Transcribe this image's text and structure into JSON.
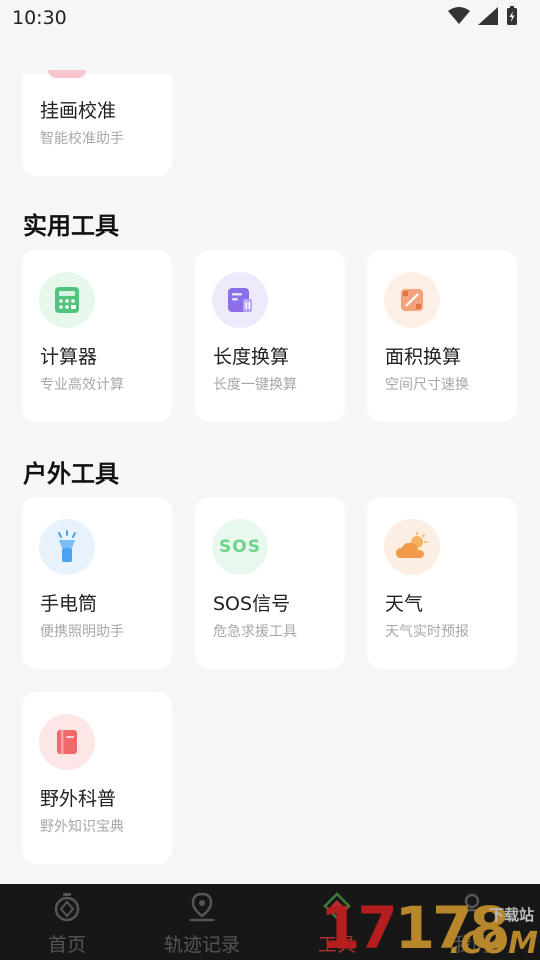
{
  "status_bar": {
    "time": "10:30"
  },
  "partial_card": {
    "title": "挂画校准",
    "subtitle": "智能校准助手"
  },
  "sections": {
    "practical": {
      "title": "实用工具",
      "items": [
        {
          "title": "计算器",
          "subtitle": "专业高效计算",
          "icon": "calculator-icon",
          "accent": "#4cc27a"
        },
        {
          "title": "长度换算",
          "subtitle": "长度一键换算",
          "icon": "ruler-convert-icon",
          "accent": "#8b6fe8"
        },
        {
          "title": "面积换算",
          "subtitle": "空间尺寸速换",
          "icon": "area-icon",
          "accent": "#f08a5d"
        }
      ]
    },
    "outdoor": {
      "title": "户外工具",
      "items": [
        {
          "title": "手电筒",
          "subtitle": "便携照明助手",
          "icon": "flashlight-icon",
          "accent": "#4aa3f0"
        },
        {
          "title": "SOS信号",
          "subtitle": "危急求援工具",
          "icon": "sos-icon",
          "accent": "#6fd38a",
          "icon_text": "SOS"
        },
        {
          "title": "天气",
          "subtitle": "天气实时预报",
          "icon": "weather-icon",
          "accent": "#f29a4a"
        },
        {
          "title": "野外科普",
          "subtitle": "野外知识宝典",
          "icon": "book-icon",
          "accent": "#ef6a6a"
        }
      ]
    }
  },
  "bottom_nav": {
    "items": [
      {
        "label": "首页",
        "icon": "stopwatch-icon"
      },
      {
        "label": "轨迹记录",
        "icon": "location-pin-icon"
      },
      {
        "label": "工具",
        "icon": "tools-icon",
        "active": true
      },
      {
        "label": "我的",
        "icon": "person-icon"
      }
    ]
  },
  "watermark": {
    "number_red": "17",
    "number_gold": "178",
    "site": "下载站",
    "suffix": ".COM"
  }
}
